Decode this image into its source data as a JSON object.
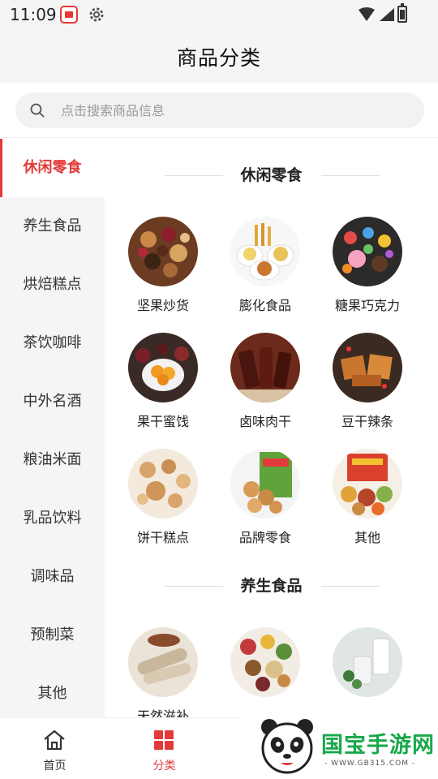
{
  "status_bar": {
    "time": "11:09"
  },
  "header": {
    "title": "商品分类"
  },
  "search": {
    "placeholder": "点击搜索商品信息"
  },
  "sidebar": {
    "items": [
      {
        "label": "休闲零食",
        "active": true
      },
      {
        "label": "养生食品",
        "active": false
      },
      {
        "label": "烘焙糕点",
        "active": false
      },
      {
        "label": "茶饮咖啡",
        "active": false
      },
      {
        "label": "中外名酒",
        "active": false
      },
      {
        "label": "粮油米面",
        "active": false
      },
      {
        "label": "乳品饮料",
        "active": false
      },
      {
        "label": "调味品",
        "active": false
      },
      {
        "label": "预制菜",
        "active": false
      },
      {
        "label": "其他",
        "active": false
      }
    ]
  },
  "sections": [
    {
      "title": "休闲零食",
      "items": [
        {
          "label": "坚果炒货",
          "icon": "nuts-image"
        },
        {
          "label": "膨化食品",
          "icon": "puffed-snacks-image"
        },
        {
          "label": "糖果巧克力",
          "icon": "candy-image"
        },
        {
          "label": "果干蜜饯",
          "icon": "dried-fruit-image"
        },
        {
          "label": "卤味肉干",
          "icon": "jerky-image"
        },
        {
          "label": "豆干辣条",
          "icon": "tofu-strips-image"
        },
        {
          "label": "饼干糕点",
          "icon": "biscuits-image"
        },
        {
          "label": "品牌零食",
          "icon": "brand-snacks-image"
        },
        {
          "label": "其他",
          "icon": "gift-box-image"
        }
      ]
    },
    {
      "title": "养生食品",
      "items": [
        {
          "label": "天然滋补",
          "icon": "yam-image"
        },
        {
          "label": "",
          "icon": "grains-image"
        },
        {
          "label": "",
          "icon": "drink-image"
        }
      ]
    }
  ],
  "bottom_nav": {
    "items": [
      {
        "label": "首页",
        "icon": "home-icon",
        "active": false
      },
      {
        "label": "分类",
        "icon": "category-icon",
        "active": true
      }
    ]
  },
  "watermark": {
    "title": "国宝手游网",
    "url": "- WWW.GB315.COM -"
  },
  "colors": {
    "accent": "#e23a3a",
    "sidebar_bg": "#f5f5f5",
    "watermark_green": "#18a84a"
  }
}
